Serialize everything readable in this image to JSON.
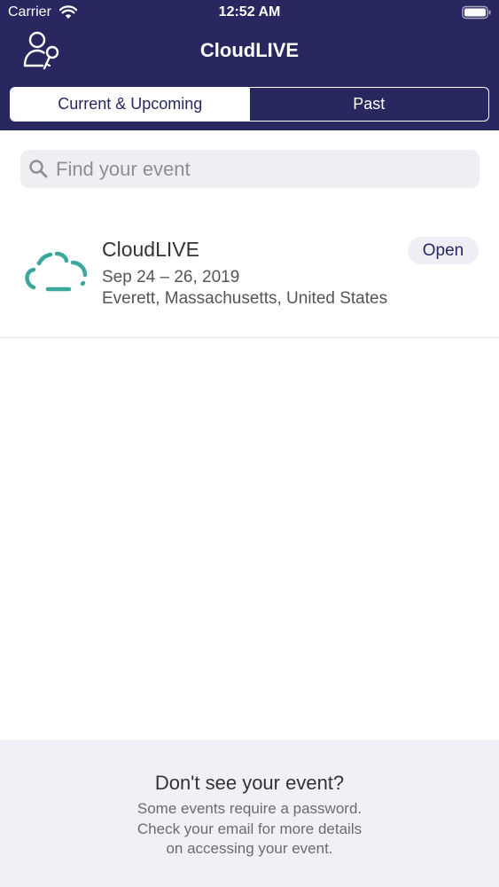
{
  "status_bar": {
    "carrier": "Carrier",
    "time": "12:52 AM"
  },
  "header": {
    "title": "CloudLIVE",
    "login_icon": "user-key-icon",
    "background_color": "#28275f"
  },
  "tabs": [
    {
      "label": "Current & Upcoming",
      "selected": true
    },
    {
      "label": "Past",
      "selected": false
    }
  ],
  "search": {
    "placeholder": "Find your event",
    "value": ""
  },
  "events": [
    {
      "name": "CloudLIVE",
      "dates": "Sep 24 – 26, 2019",
      "location": "Everett, Massachusetts, United States",
      "status": "Open",
      "logo_icon": "cloud-logo-icon",
      "logo_color": "#3aa89a"
    }
  ],
  "footer": {
    "title": "Don't see your event?",
    "line1": "Some events require a password.",
    "line2": "Check your email for more details",
    "line3": "on accessing your event."
  }
}
